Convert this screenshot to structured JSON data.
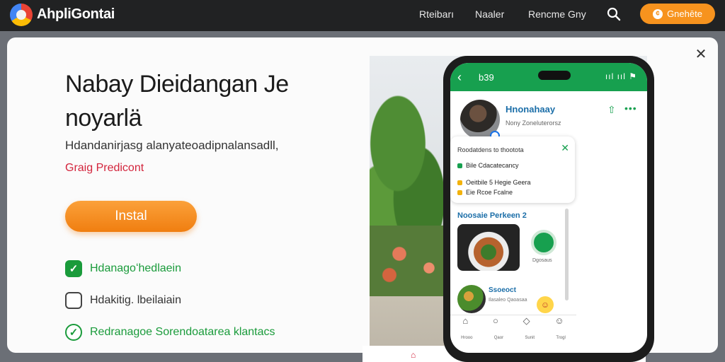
{
  "topbar": {
    "brand": "AhpliGontai",
    "nav": [
      "Rteibarı",
      "Naaler",
      "Rencme Gny"
    ],
    "cta_label": "Gnehēte",
    "cta_icon": "coin-icon"
  },
  "modal": {
    "headline": "Nabay Dieidangan Je noyarlä",
    "subtext": "Hdandanirjasg alanyateoadipnalansadll,",
    "price": "Graig Predicont",
    "install_label": "Instal",
    "options": [
      {
        "label": "Hdanagoʻhedlaein",
        "state": "checked"
      },
      {
        "label": "Hdakitig. lbeilaiain",
        "state": "unchecked"
      },
      {
        "label": "Redranagoe Sorendoatarea klantacs",
        "state": "ring"
      }
    ]
  },
  "phone": {
    "time": "b39",
    "status": "ııl ııl ⚑",
    "profile_name": "Hnonahaay",
    "profile_sub": "Nony Zoneluterorsz",
    "card": {
      "title": "Roodatdens to thootota",
      "rows": [
        "Bile Cdacatecancy",
        "Oeitbile 5 Hegie Geera",
        "Eie Rcoe Fcalne"
      ]
    },
    "section_title": "Noosaie Perkeen 2",
    "food_badge_label": "Dgosaus",
    "veg_title": "Ssoeoct",
    "veg_sub": "Ilasaleo Qaoasaa",
    "tabs": [
      "Hrooo",
      "Qaor",
      "Sunit",
      "Trogl"
    ]
  }
}
